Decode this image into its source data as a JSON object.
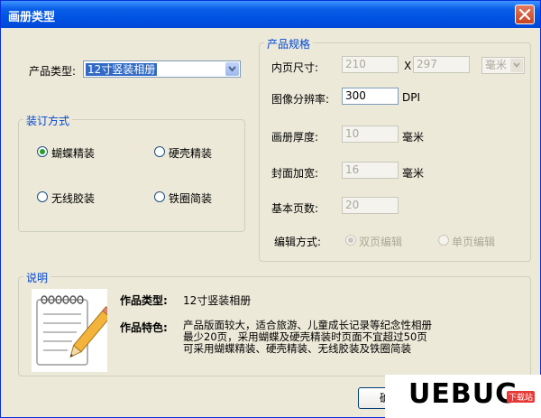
{
  "window": {
    "title": "画册类型"
  },
  "product_type": {
    "label": "产品类型:",
    "selected": "12寸竖装相册"
  },
  "binding": {
    "title": "装订方式",
    "options": [
      {
        "label": "蝴蝶精装",
        "checked": true
      },
      {
        "label": "硬壳精装",
        "checked": false
      },
      {
        "label": "无线胶装",
        "checked": false
      },
      {
        "label": "铁圈简装",
        "checked": false
      }
    ]
  },
  "spec": {
    "title": "产品规格",
    "page_size": {
      "label": "内页尺寸:",
      "width": "210",
      "x": "X",
      "height": "297",
      "unit": "毫米"
    },
    "resolution": {
      "label": "图像分辨率:",
      "value": "300",
      "unit": "DPI"
    },
    "thickness": {
      "label": "画册厚度:",
      "value": "10",
      "unit": "毫米"
    },
    "cover_widen": {
      "label": "封面加宽:",
      "value": "16",
      "unit": "毫米"
    },
    "base_pages": {
      "label": "基本页数:",
      "value": "20"
    },
    "edit_mode": {
      "label": "编辑方式:",
      "options": [
        "双页编辑",
        "单页编辑"
      ]
    }
  },
  "description": {
    "title": "说明",
    "type_label": "作品类型:",
    "type_value": "12寸竖装相册",
    "feature_label": "作品特色:",
    "feature_lines": [
      "产品版面较大，适合旅游、儿童成长记录等纪念性相册",
      "最少20页，采用蝴蝶及硬壳精装时页面不宜超过50页",
      "可采用蝴蝶精装、硬壳精装、无线胶装及铁圈简装"
    ]
  },
  "buttons": {
    "ok": "确"
  },
  "watermark": {
    "brand": "UEBUG",
    "sub": "下载站"
  },
  "colors": {
    "titlebar": "#0054E3",
    "group_title": "#0046D5",
    "selection": "#316AC5",
    "background": "#ECE9D8"
  }
}
